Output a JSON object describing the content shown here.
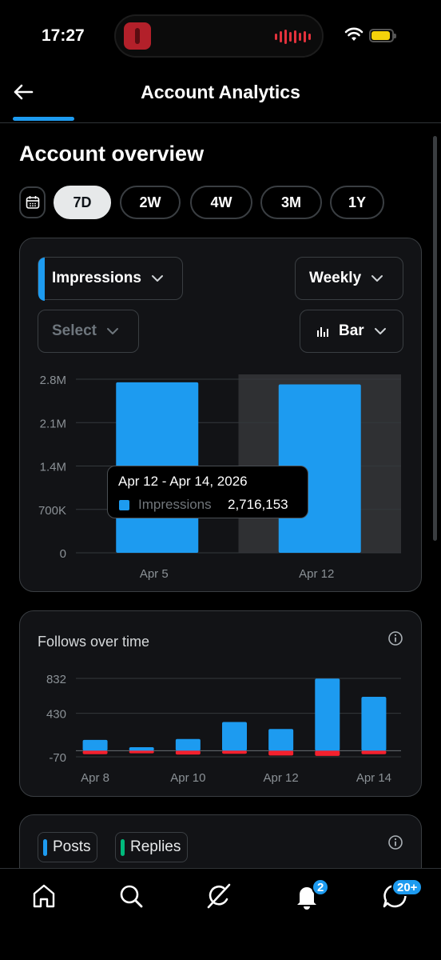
{
  "status_bar": {
    "time": "17:27"
  },
  "header": {
    "title": "Account Analytics"
  },
  "overview": {
    "title": "Account overview",
    "ranges": [
      "7D",
      "2W",
      "4W",
      "3M",
      "1Y"
    ],
    "active_range": "7D"
  },
  "impressions_card": {
    "metric": "Impressions",
    "secondary_metric_placeholder": "Select",
    "interval": "Weekly",
    "chart_style": "Bar",
    "tooltip": {
      "title": "Apr 12 - Apr 14, 2026",
      "label": "Impressions",
      "value": "2,716,153"
    }
  },
  "follows_card": {
    "title": "Follows over time"
  },
  "posts_card": {
    "legend": [
      "Posts",
      "Replies"
    ]
  },
  "colors": {
    "accent": "#1d9bf0",
    "negative": "#f4212e",
    "replies": "#00ba7c"
  },
  "bottom_nav": {
    "items": [
      "home-icon",
      "search-icon",
      "grok-icon",
      "notifications-icon",
      "messages-icon"
    ],
    "notifications_badge": "2",
    "messages_badge": "20+"
  },
  "chart_data": [
    {
      "type": "bar",
      "categories": [
        "Apr 5",
        "Apr 12"
      ],
      "series": [
        {
          "name": "Impressions",
          "values": [
            2750000,
            2716153
          ]
        }
      ],
      "y_ticks": [
        "2.8M",
        "2.1M",
        "1.4M",
        "700K",
        "0"
      ],
      "ylim": [
        0,
        2800000
      ],
      "highlighted_category": "Apr 12",
      "grid": true
    },
    {
      "type": "bar",
      "title": "Follows over time",
      "categories": [
        "Apr 8",
        "Apr 9",
        "Apr 10",
        "Apr 11",
        "Apr 12",
        "Apr 13",
        "Apr 14"
      ],
      "x_tick_labels": [
        "Apr 8",
        "Apr 10",
        "Apr 12",
        "Apr 14"
      ],
      "series": [
        {
          "values": [
            125,
            40,
            135,
            330,
            250,
            830,
            620
          ]
        },
        {
          "values": [
            -40,
            -30,
            -45,
            -35,
            -55,
            -60,
            -40
          ]
        }
      ],
      "y_ticks": [
        "832",
        "430",
        "-70"
      ],
      "ylim": [
        -70,
        832
      ],
      "grid": true
    }
  ]
}
